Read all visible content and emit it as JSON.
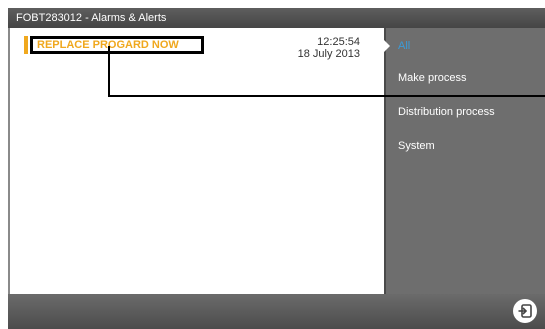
{
  "window": {
    "title": "FOBT283012 - Alarms & Alerts"
  },
  "alarms": [
    {
      "message": "REPLACE PROGARD NOW",
      "time": "12:25:54",
      "date": "18 July 2013",
      "color": "#f0a81e"
    }
  ],
  "sidebar": {
    "items": [
      {
        "label": "All",
        "active": true
      },
      {
        "label": "Make process",
        "active": false
      },
      {
        "label": "Distribution process",
        "active": false
      },
      {
        "label": "System",
        "active": false
      }
    ],
    "active_color": "#3b9bd8"
  },
  "footer": {
    "exit_icon": "exit-icon"
  }
}
